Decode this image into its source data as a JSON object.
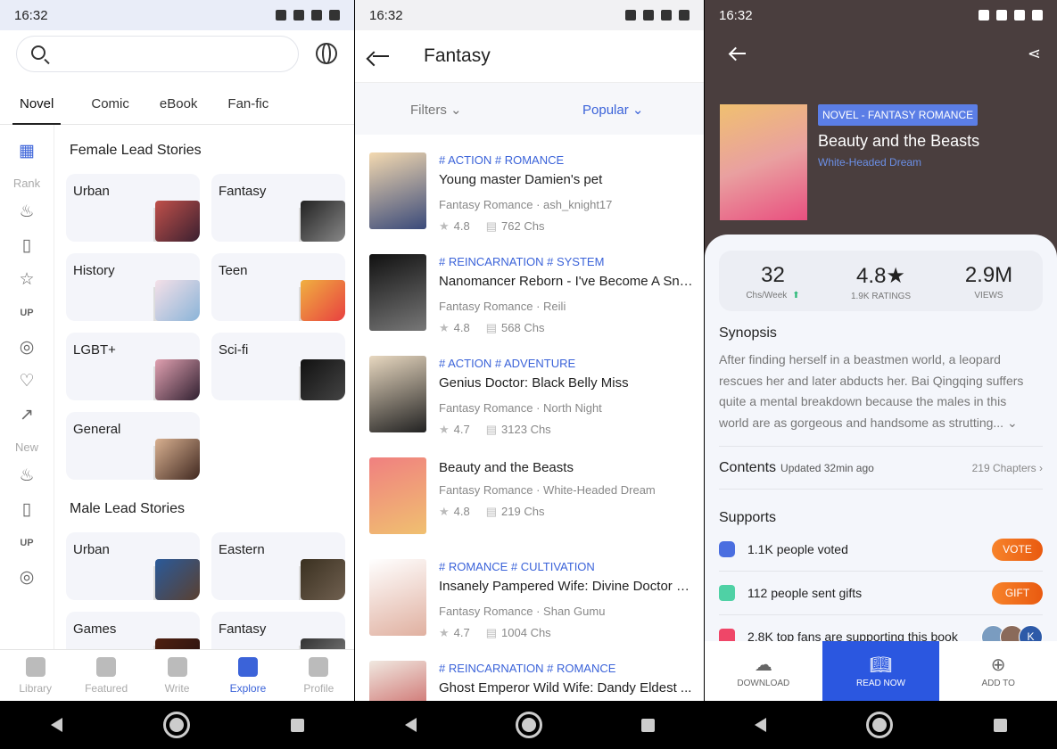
{
  "status": {
    "time": "16:32"
  },
  "explore": {
    "tabs": [
      "Novel",
      "Comic",
      "eBook",
      "Fan-fic"
    ],
    "sidebar": {
      "rank_label": "Rank",
      "new_label": "New"
    },
    "sections": [
      {
        "title": "Female Lead Stories",
        "categories": [
          "Urban",
          "Fantasy",
          "History",
          "Teen",
          "LGBT+",
          "Sci-fi",
          "General"
        ]
      },
      {
        "title": "Male Lead Stories",
        "categories": [
          "Urban",
          "Eastern",
          "Games",
          "Fantasy"
        ]
      }
    ],
    "bottom_nav": [
      "Library",
      "Featured",
      "Write",
      "Explore",
      "Profile"
    ],
    "active_nav": "Explore",
    "accent": "#3b63d9"
  },
  "genre": {
    "title": "Fantasy",
    "filters_label": "Filters",
    "sort_label": "Popular",
    "books": [
      {
        "tags": "# ACTION # ROMANCE",
        "title": "Young master Damien's pet",
        "meta": "Fantasy Romance · ash_knight17",
        "rating": "4.8",
        "chapters": "762 Chs"
      },
      {
        "tags": "# REINCARNATION # SYSTEM",
        "title": "Nanomancer Reborn - I've Become A Sno...",
        "meta": "Fantasy Romance · Reili",
        "rating": "4.8",
        "chapters": "568 Chs"
      },
      {
        "tags": "# ACTION # ADVENTURE",
        "title": "Genius Doctor: Black Belly Miss",
        "meta": "Fantasy Romance · North Night",
        "rating": "4.7",
        "chapters": "3123 Chs"
      },
      {
        "tags": "",
        "title": "Beauty and the Beasts",
        "meta": "Fantasy Romance · White-Headed Dream",
        "rating": "4.8",
        "chapters": "219 Chs"
      },
      {
        "tags": "# ROMANCE # CULTIVATION",
        "title": "Insanely Pampered Wife: Divine Doctor F...",
        "meta": "Fantasy Romance · Shan Gumu",
        "rating": "4.7",
        "chapters": "1004 Chs"
      },
      {
        "tags": "# REINCARNATION # ROMANCE",
        "title": "Ghost Emperor Wild Wife: Dandy Eldest ...",
        "meta": "",
        "rating": "",
        "chapters": ""
      }
    ]
  },
  "detail": {
    "badge": "NOVEL - FANTASY ROMANCE",
    "title": "Beauty and the Beasts",
    "author": "White-Headed Dream",
    "stats": [
      {
        "value": "32",
        "label": "Chs/Week"
      },
      {
        "value": "4.8★",
        "label": "1.9K RATINGS"
      },
      {
        "value": "2.9M",
        "label": "VIEWS"
      }
    ],
    "synopsis_title": "Synopsis",
    "synopsis": "After finding herself in a beastmen world, a leopard rescues her and later abducts her. Bai Qingqing suffers quite a mental breakdown because the males in this world are as gorgeous and handsome as strutting...",
    "contents_title": "Contents",
    "updated": "Updated 32min ago",
    "chapters": "219 Chapters",
    "supports_title": "Supports",
    "votes": "1.1K people voted",
    "vote_btn": "VOTE",
    "gifts": "112 people sent gifts",
    "gift_btn": "GIFT",
    "fans": "2.8K top fans are supporting this book",
    "fan_avatar_initial": "K",
    "actions": [
      "DOWNLOAD",
      "READ NOW",
      "ADD TO"
    ]
  }
}
